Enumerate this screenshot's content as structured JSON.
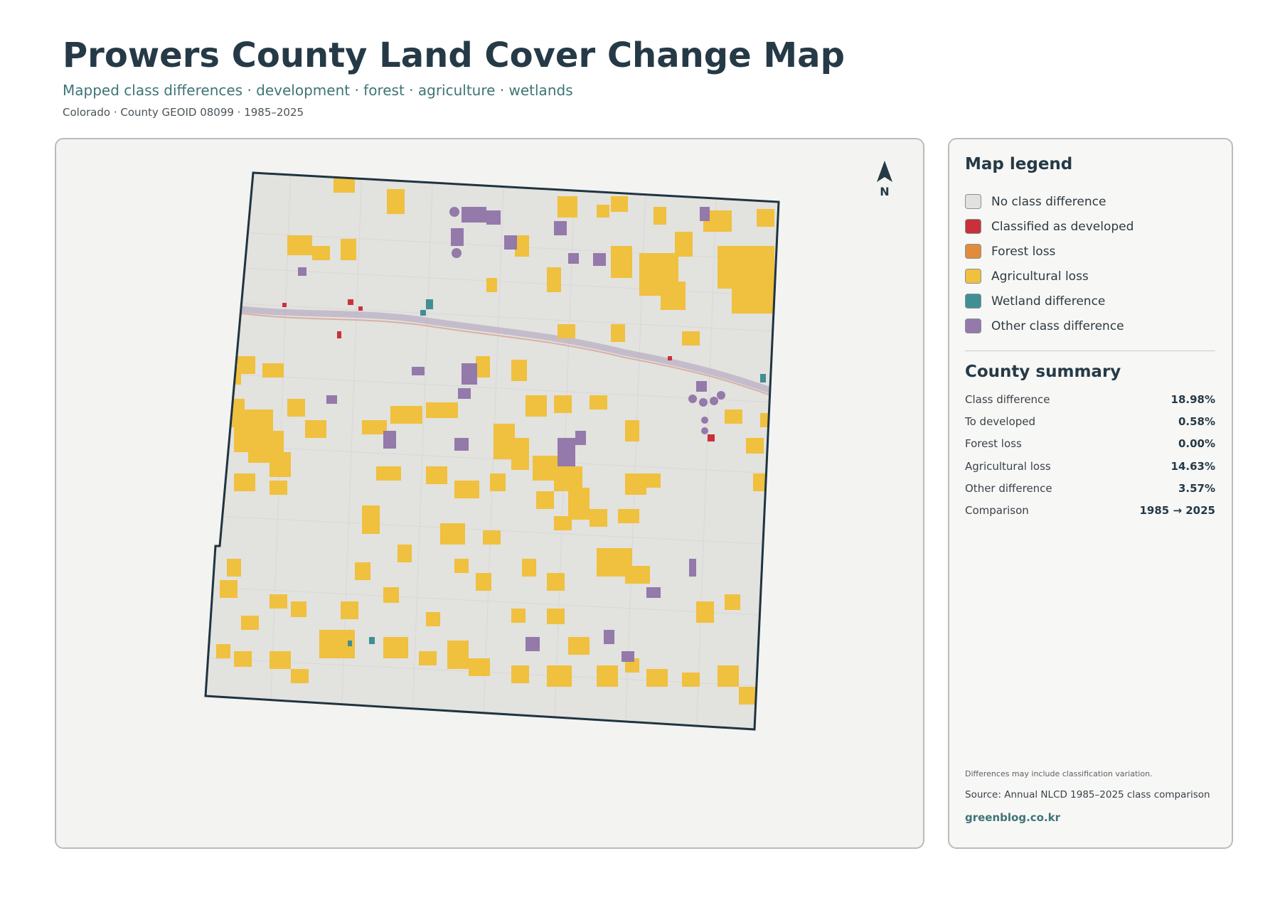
{
  "header": {
    "title": "Prowers County Land Cover Change Map",
    "subtitle": "Mapped class differences · development · forest · agriculture · wetlands",
    "meta": "Colorado · County GEOID 08099 · 1985–2025"
  },
  "map": {
    "north_label": "N",
    "north_icon": "north-arrow-icon"
  },
  "legend": {
    "title": "Map legend",
    "items": [
      {
        "label": "No class difference",
        "color": "#e2e2de"
      },
      {
        "label": "Classified as developed",
        "color": "#c8313b"
      },
      {
        "label": "Forest loss",
        "color": "#e08c3c"
      },
      {
        "label": "Agricultural loss",
        "color": "#f0c03f"
      },
      {
        "label": "Wetland difference",
        "color": "#3f8f94"
      },
      {
        "label": "Other class difference",
        "color": "#9479ab"
      }
    ]
  },
  "summary": {
    "title": "County summary",
    "rows": [
      {
        "label": "Class difference",
        "value": "18.98%"
      },
      {
        "label": "To developed",
        "value": "0.58%"
      },
      {
        "label": "Forest loss",
        "value": "0.00%"
      },
      {
        "label": "Agricultural loss",
        "value": "14.63%"
      },
      {
        "label": "Other difference",
        "value": "3.57%"
      },
      {
        "label": "Comparison",
        "value": "1985 → 2025"
      }
    ]
  },
  "footer": {
    "note": "Differences may include classification variation.",
    "source": "Source: Annual NLCD 1985–2025 class comparison",
    "site": "greenblog.co.kr"
  }
}
